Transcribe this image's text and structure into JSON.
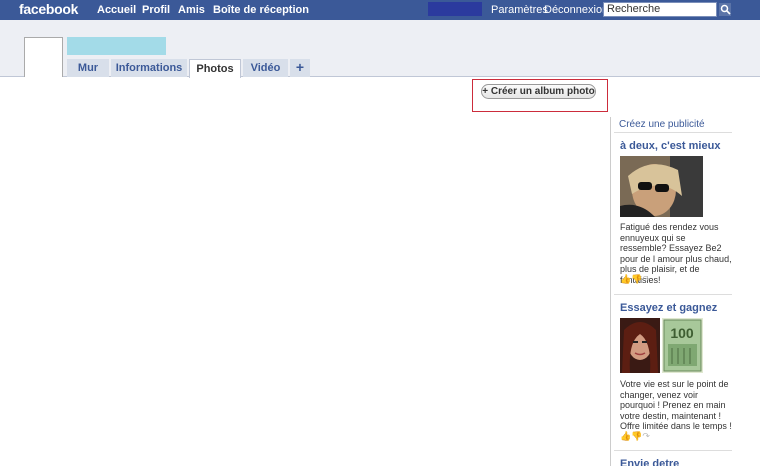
{
  "topbar": {
    "logo": "facebook",
    "nav": [
      "Accueil",
      "Profil",
      "Amis",
      "Boîte de réception"
    ],
    "params": "Paramètres",
    "logout": "Déconnexion",
    "search_placeholder": "Recherche"
  },
  "tabs": [
    "Mur",
    "Informations",
    "Photos",
    "Vidéo",
    "+"
  ],
  "album_button": "+ Créer un album photo",
  "ads": {
    "create_link": "Créez une publicité",
    "items": [
      {
        "title": "à deux, c'est mieux",
        "text": "Fatigué des rendez vous ennuyeux qui se ressemble? Essayez Be2 pour de l amour plus chaud, plus de plaisir, et de fantaisies!",
        "actions": "👍👎↷"
      },
      {
        "title": "Essayez et gagnez",
        "text": "Votre vie est sur le point de changer, venez voir pourquoi ! Prenez en main votre destin, maintenant ! Offre limitée dans le temps !",
        "actions": "👍👎↷"
      },
      {
        "title": "Envie detre"
      }
    ]
  }
}
